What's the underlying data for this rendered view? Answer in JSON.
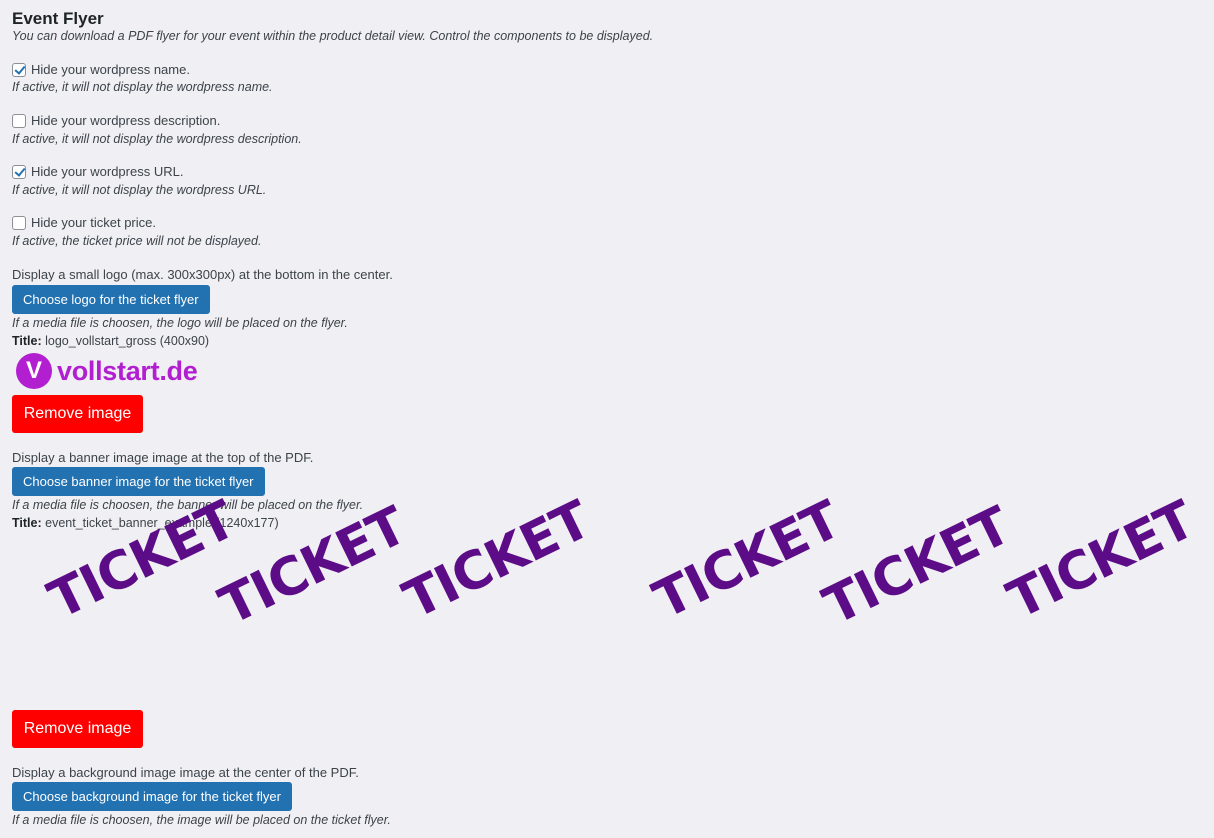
{
  "section": {
    "title": "Event Flyer",
    "description": "You can download a PDF flyer for your event within the product detail view. Control the components to be displayed."
  },
  "options": [
    {
      "label": "Hide your wordpress name.",
      "checked": true,
      "help": "If active, it will not display the wordpress name."
    },
    {
      "label": "Hide your wordpress description.",
      "checked": false,
      "help": "If active, it will not display the wordpress description."
    },
    {
      "label": "Hide your wordpress URL.",
      "checked": true,
      "help": "If active, it will not display the wordpress URL."
    },
    {
      "label": "Hide your ticket price.",
      "checked": false,
      "help": "If active, the ticket price will not be displayed."
    }
  ],
  "logo": {
    "intro": "Display a small logo (max. 300x300px) at the bottom in the center.",
    "button": "Choose logo for the ticket flyer",
    "help": "If a media file is choosen, the logo will be placed on the flyer.",
    "title_label": "Title:",
    "title_value": " logo_vollstart_gross (400x90)",
    "preview_letter": "V",
    "preview_text": "vollstart.de",
    "remove": "Remove image"
  },
  "banner": {
    "intro": "Display a banner image image at the top of the PDF.",
    "button": "Choose banner image for the ticket flyer",
    "help": "If a media file is choosen, the banner will be placed on the flyer.",
    "title_label": "Title:",
    "title_value": " event_ticket_banner_example (1240x177)",
    "preview_words": [
      "TICKET",
      "TICKET",
      "TICKET",
      "TICKET",
      "TICKET",
      "TICKET"
    ],
    "remove": "Remove image"
  },
  "background": {
    "intro": "Display a background image image at the center of the PDF.",
    "button": "Choose background image for the ticket flyer",
    "help": "If a media file is choosen, the image will be placed on the ticket flyer."
  },
  "colors": {
    "primary_button": "#2271b1",
    "remove_button": "#ff0000",
    "logo_purple": "#b21fd1",
    "ticket_purple": "#5b0c86"
  }
}
